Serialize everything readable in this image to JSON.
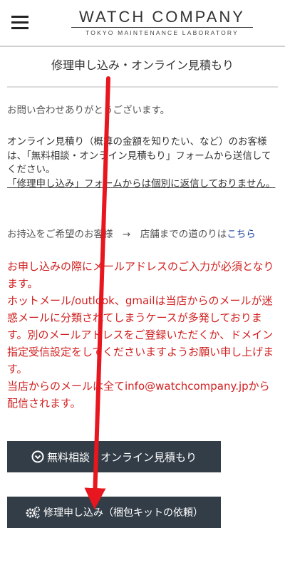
{
  "header": {
    "menu_icon": "hamburger-icon",
    "logo_main": "WATCH COMPANY",
    "logo_sub": "TOKYO MAINTENANCE LABORATORY"
  },
  "page": {
    "title": "修理申し込み・オンライン見積もり",
    "thanks": "お問い合わせありがとうございます。",
    "estimate_note": "オンライン見積り（概算の金額を知りたい、など）のお客様は、「無料相談・オンライン見積もり」フォームから送信してください。",
    "no_reply_note": "「修理申し込み」フォームからは個別に返信しておりません。",
    "visit_prefix": "お持込をご希望のお客様　→　店舗までの道のりは",
    "visit_link": "こちら",
    "warning": [
      "お申し込みの際にメールアドレスのご入力が必須となります。",
      "ホットメール/outlook、gmailは当店からのメールが迷惑メールに分類されてしまうケースが多発しております。別のメールアドレスをご登録いただくか、ドメイン指定受信設定をしてくださいますようお願い申し上げます。",
      "当店からのメールは全てinfo@watchcompany.jpから配信されます。"
    ]
  },
  "buttons": {
    "consult_label": "無料相談・オンライン見積もり",
    "consult_icon": "chevron-circle-down-icon",
    "repair_label": "修理申し込み（梱包キットの依頼）",
    "repair_icon": "gears-icon"
  },
  "annotation": {
    "color": "#e8161e"
  }
}
